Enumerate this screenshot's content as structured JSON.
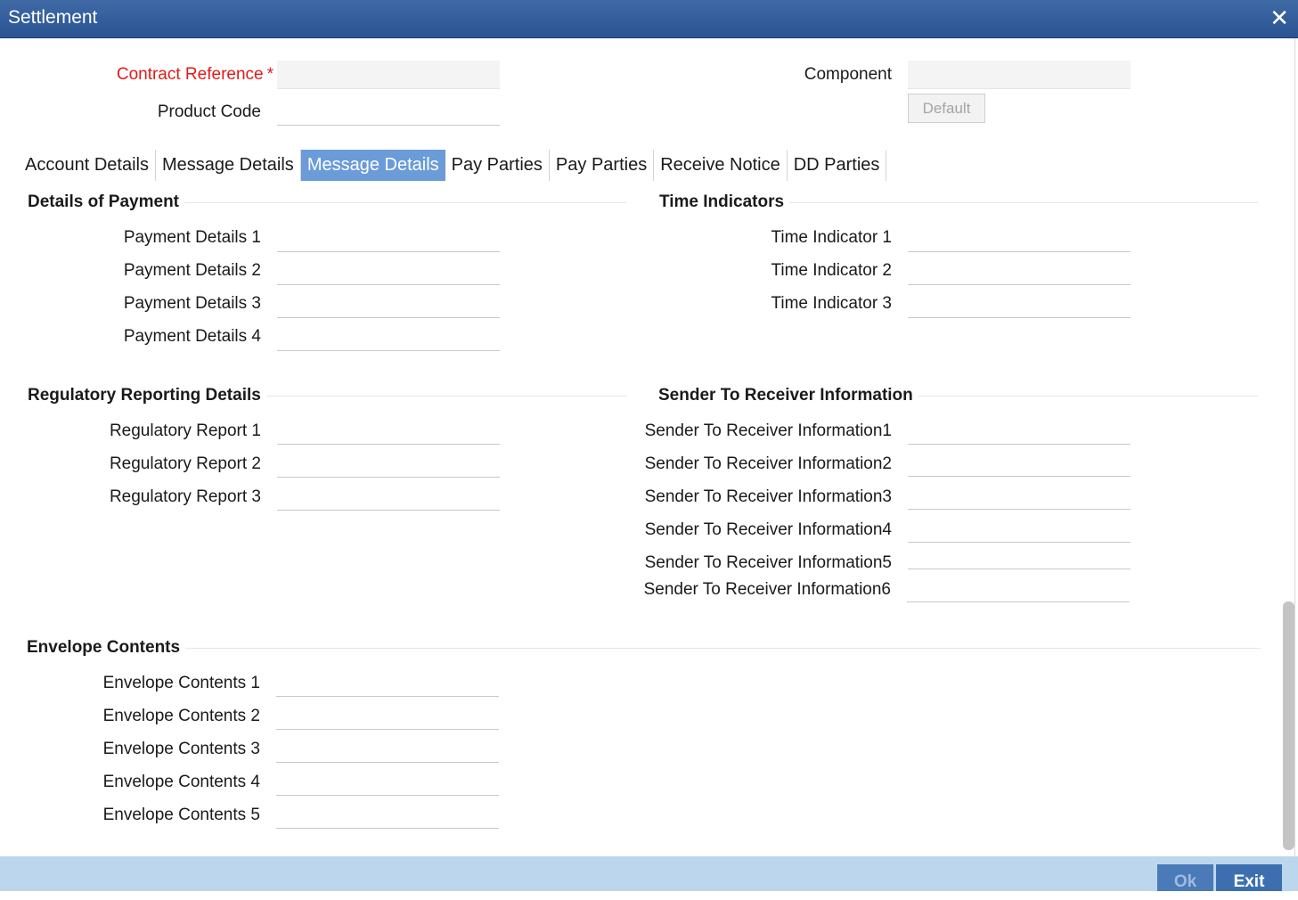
{
  "window": {
    "title": "Settlement",
    "close_glyph": "✕"
  },
  "header": {
    "contract_reference_label": "Contract Reference",
    "required_mark": "*",
    "product_code_label": "Product Code",
    "component_label": "Component",
    "default_button": "Default"
  },
  "tabs": [
    "Account Details",
    "Message Details",
    "Message Details",
    "Pay Parties",
    "Pay Parties",
    "Receive Notice",
    "DD Parties"
  ],
  "active_tab_index": 2,
  "sections": {
    "payment": {
      "title": "Details of Payment",
      "labels": [
        "Payment Details 1",
        "Payment Details 2",
        "Payment Details 3",
        "Payment Details 4"
      ]
    },
    "time": {
      "title": "Time Indicators",
      "labels": [
        "Time Indicator 1",
        "Time Indicator 2",
        "Time Indicator 3"
      ]
    },
    "regulatory": {
      "title": "Regulatory Reporting Details",
      "labels": [
        "Regulatory Report 1",
        "Regulatory Report 2",
        "Regulatory Report 3"
      ]
    },
    "sender": {
      "title": "Sender To Receiver Information",
      "labels": [
        "Sender To Receiver Information1",
        "Sender To Receiver Information2",
        "Sender To Receiver Information3",
        "Sender To Receiver Information4",
        "Sender To Receiver Information5",
        "Sender To Receiver Information6"
      ]
    },
    "envelope": {
      "title": "Envelope Contents",
      "labels": [
        "Envelope Contents 1",
        "Envelope Contents 2",
        "Envelope Contents 3",
        "Envelope Contents 4",
        "Envelope Contents 5"
      ]
    }
  },
  "footer": {
    "ok": "Ok",
    "exit": "Exit"
  },
  "colors": {
    "titlebar": "#2f5c9c",
    "active_tab": "#6b9bd8",
    "required": "#e01a1a",
    "footer": "#bcd6ee",
    "footer_button": "#3d6fb0"
  }
}
